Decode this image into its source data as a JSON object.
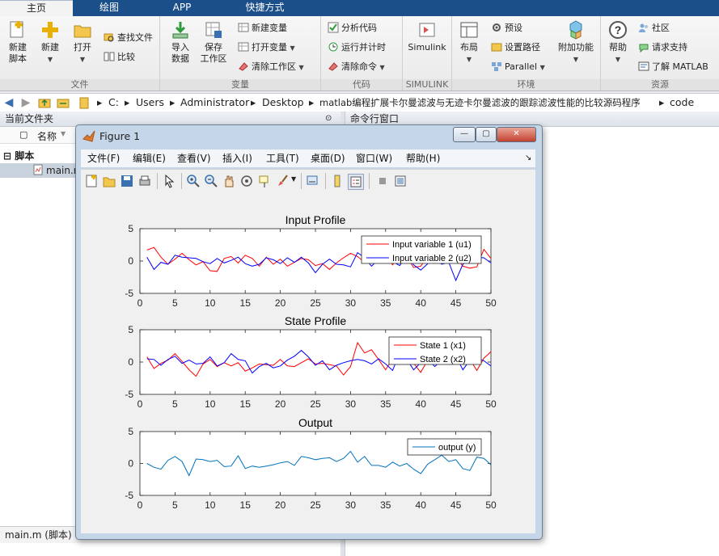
{
  "tabs": [
    {
      "label": "主页",
      "active": true
    },
    {
      "label": "绘图",
      "active": false
    },
    {
      "label": "APP",
      "active": false
    },
    {
      "label": "快捷方式",
      "active": false
    }
  ],
  "ribbon": {
    "file": {
      "label": "文件",
      "new_script": "新建\n脚本",
      "new": "新建",
      "open": "打开",
      "find_files": "查找文件",
      "compare": "比较"
    },
    "variable": {
      "label": "变量",
      "import": "导入\n数据",
      "save_ws": "保存\n工作区",
      "new_var": "新建变量",
      "open_var": "打开变量",
      "clear_ws": "清除工作区"
    },
    "code": {
      "label": "代码",
      "analyze": "分析代码",
      "run_time": "运行并计时",
      "clear_cmd": "清除命令"
    },
    "simulink": {
      "label": "SIMULINK",
      "simulink": "Simulink"
    },
    "env": {
      "label": "环境",
      "layout": "布局",
      "prefs": "预设",
      "set_path": "设置路径",
      "parallel": "Parallel",
      "addons": "附加功能"
    },
    "resources": {
      "label": "资源",
      "help": "帮助",
      "community": "社区",
      "support": "请求支持",
      "learn": "了解 MATLAB"
    }
  },
  "address": {
    "crumbs": [
      "C:",
      "Users",
      "Administrator",
      "Desktop",
      "matlab编程扩展卡尔曼滤波与无迹卡尔曼滤波的跟踪滤波性能的比较源码程序",
      "code"
    ]
  },
  "left_pane": {
    "title": "当前文件夹",
    "column": "名称",
    "group": "脚本",
    "file": "main.m",
    "details": "main.m  (脚本)"
  },
  "right_pane": {
    "title": "命令行窗口"
  },
  "figure": {
    "title": "Figure 1",
    "menus": [
      "文件(F)",
      "编辑(E)",
      "查看(V)",
      "插入(I)",
      "工具(T)",
      "桌面(D)",
      "窗口(W)",
      "帮助(H)"
    ]
  },
  "colors": {
    "red": "#ff0000",
    "blue": "#0000ff",
    "teal": "#0072bd",
    "ribbon_blue": "#1b4f8a"
  },
  "chart_data": [
    {
      "type": "line",
      "title": "Input Profile",
      "xlim": [
        0,
        50
      ],
      "ylim": [
        -5,
        5
      ],
      "xticks": [
        0,
        5,
        10,
        15,
        20,
        25,
        30,
        35,
        40,
        45,
        50
      ],
      "yticks": [
        -5,
        0,
        5
      ],
      "legend_position": "top-right",
      "series": [
        {
          "name": "Input variable 1 (u1)",
          "color": "#ff0000",
          "x": [
            1,
            2,
            3,
            4,
            5,
            6,
            7,
            8,
            9,
            10,
            11,
            12,
            13,
            14,
            15,
            16,
            17,
            18,
            19,
            20,
            21,
            22,
            23,
            24,
            25,
            26,
            27,
            28,
            29,
            30,
            31,
            32,
            33,
            34,
            35,
            36,
            37,
            38,
            39,
            40,
            41,
            42,
            43,
            44,
            45,
            46,
            47,
            48,
            49,
            50
          ],
          "values": [
            1.7,
            2.1,
            0.6,
            -0.5,
            0.3,
            1.2,
            0.2,
            -0.6,
            -0.1,
            -1.5,
            -1.6,
            0.4,
            0.7,
            -0.3,
            0.9,
            0.4,
            -0.8,
            0.6,
            -0.5,
            0.3,
            -0.8,
            -0.2,
            0.4,
            0.2,
            -0.7,
            -0.4,
            -1.3,
            -0.3,
            0.5,
            1.2,
            0.7,
            -0.2,
            0.3,
            1.3,
            0.8,
            -0.6,
            1.2,
            0.6,
            -1.0,
            -0.8,
            0.7,
            1.4,
            0.4,
            -0.2,
            0.6,
            -0.8,
            -1.1,
            -0.9,
            1.8,
            0.4
          ]
        },
        {
          "name": "Input variable 2 (u2)",
          "color": "#0000ff",
          "x": [
            1,
            2,
            3,
            4,
            5,
            6,
            7,
            8,
            9,
            10,
            11,
            12,
            13,
            14,
            15,
            16,
            17,
            18,
            19,
            20,
            21,
            22,
            23,
            24,
            25,
            26,
            27,
            28,
            29,
            30,
            31,
            32,
            33,
            34,
            35,
            36,
            37,
            38,
            39,
            40,
            41,
            42,
            43,
            44,
            45,
            46,
            47,
            48,
            49,
            50
          ],
          "values": [
            0.6,
            -1.3,
            -0.2,
            -0.5,
            0.9,
            0.6,
            0.5,
            0.4,
            -0.1,
            -0.4,
            0.4,
            -0.3,
            0.1,
            0.6,
            -0.4,
            -0.8,
            -0.5,
            0.5,
            0.2,
            -0.4,
            0.5,
            -0.2,
            0.6,
            -0.3,
            -1.8,
            -0.5,
            0.3,
            -0.5,
            -0.6,
            -0.9,
            1.3,
            0.5,
            -0.8,
            0.3,
            -0.3,
            -0.1,
            -0.7,
            0.7,
            -0.6,
            -1.4,
            -0.4,
            0.4,
            -0.5,
            -0.2,
            -3.0,
            -0.5,
            0.2,
            0.6,
            0.5,
            -0.3
          ]
        }
      ]
    },
    {
      "type": "line",
      "title": "State Profile",
      "xlim": [
        0,
        50
      ],
      "ylim": [
        -5,
        5
      ],
      "xticks": [
        0,
        5,
        10,
        15,
        20,
        25,
        30,
        35,
        40,
        45,
        50
      ],
      "yticks": [
        -5,
        0,
        5
      ],
      "legend_position": "top-right",
      "series": [
        {
          "name": "State 1 (x1)",
          "color": "#ff0000",
          "x": [
            1,
            2,
            3,
            4,
            5,
            6,
            7,
            8,
            9,
            10,
            11,
            12,
            13,
            14,
            15,
            16,
            17,
            18,
            19,
            20,
            21,
            22,
            23,
            24,
            25,
            26,
            27,
            28,
            29,
            30,
            31,
            32,
            33,
            34,
            35,
            36,
            37,
            38,
            39,
            40,
            41,
            42,
            43,
            44,
            45,
            46,
            47,
            48,
            49,
            50
          ],
          "values": [
            0.8,
            -1.0,
            -0.2,
            0.3,
            1.3,
            0.1,
            -1.2,
            -2.2,
            -0.3,
            0.4,
            -0.7,
            -0.1,
            -0.6,
            -0.1,
            -1.4,
            -0.9,
            -0.3,
            -0.4,
            -0.5,
            0.4,
            -0.6,
            -0.7,
            -0.1,
            0.5,
            -0.3,
            -0.2,
            -0.4,
            -0.6,
            -2.0,
            -0.7,
            3.0,
            1.4,
            1.9,
            0.4,
            -1.2,
            0.6,
            0.2,
            -0.1,
            -0.2,
            -1.6,
            0.3,
            0.7,
            1.1,
            0.4,
            0.6,
            -0.3,
            0.4,
            -1.3,
            0.6,
            1.6
          ]
        },
        {
          "name": "State 2 (x2)",
          "color": "#0000ff",
          "x": [
            1,
            2,
            3,
            4,
            5,
            6,
            7,
            8,
            9,
            10,
            11,
            12,
            13,
            14,
            15,
            16,
            17,
            18,
            19,
            20,
            21,
            22,
            23,
            24,
            25,
            26,
            27,
            28,
            29,
            30,
            31,
            32,
            33,
            34,
            35,
            36,
            37,
            38,
            39,
            40,
            41,
            42,
            43,
            44,
            45,
            46,
            47,
            48,
            49,
            50
          ],
          "values": [
            0.5,
            0.4,
            -0.5,
            0.4,
            0.9,
            -0.2,
            0.3,
            -0.3,
            -0.2,
            0.8,
            -0.6,
            -0.1,
            1.3,
            0.4,
            0.2,
            -1.7,
            -0.7,
            -0.2,
            -0.9,
            -0.6,
            0.3,
            0.9,
            1.8,
            0.8,
            -0.5,
            0.2,
            -1.2,
            -0.5,
            -0.1,
            0.2,
            0.4,
            0.2,
            -0.3,
            0.5,
            -0.3,
            -1.3,
            1.5,
            0.4,
            -1.2,
            -0.1,
            0.4,
            -0.7,
            0.3,
            0.5,
            1.0,
            -1.2,
            0.3,
            0.6,
            0.2,
            -0.6
          ]
        }
      ]
    },
    {
      "type": "line",
      "title": "Output",
      "xlim": [
        0,
        50
      ],
      "ylim": [
        -5,
        5
      ],
      "xticks": [
        0,
        5,
        10,
        15,
        20,
        25,
        30,
        35,
        40,
        45,
        50
      ],
      "yticks": [
        -5,
        0,
        5
      ],
      "legend_position": "top-right",
      "series": [
        {
          "name": "output (y)",
          "color": "#0072bd",
          "x": [
            1,
            2,
            3,
            4,
            5,
            6,
            7,
            8,
            9,
            10,
            11,
            12,
            13,
            14,
            15,
            16,
            17,
            18,
            19,
            20,
            21,
            22,
            23,
            24,
            25,
            26,
            27,
            28,
            29,
            30,
            31,
            32,
            33,
            34,
            35,
            36,
            37,
            38,
            39,
            40,
            41,
            42,
            43,
            44,
            45,
            46,
            47,
            48,
            49,
            50
          ],
          "values": [
            0.0,
            -0.6,
            -0.9,
            0.5,
            1.1,
            0.3,
            -1.9,
            0.7,
            0.6,
            0.3,
            0.5,
            -0.5,
            -0.4,
            1.2,
            -0.8,
            -0.4,
            -0.6,
            -0.4,
            -0.2,
            0.1,
            0.3,
            -0.3,
            1.1,
            0.9,
            0.6,
            0.8,
            0.9,
            0.3,
            0.8,
            1.9,
            0.2,
            1.1,
            -0.3,
            -0.3,
            -0.6,
            0.2,
            -0.4,
            0.0,
            -0.9,
            -1.6,
            -0.1,
            0.6,
            1.3,
            0.3,
            0.6,
            -0.8,
            -1.1,
            1.0,
            0.8,
            -0.2
          ]
        }
      ]
    }
  ]
}
